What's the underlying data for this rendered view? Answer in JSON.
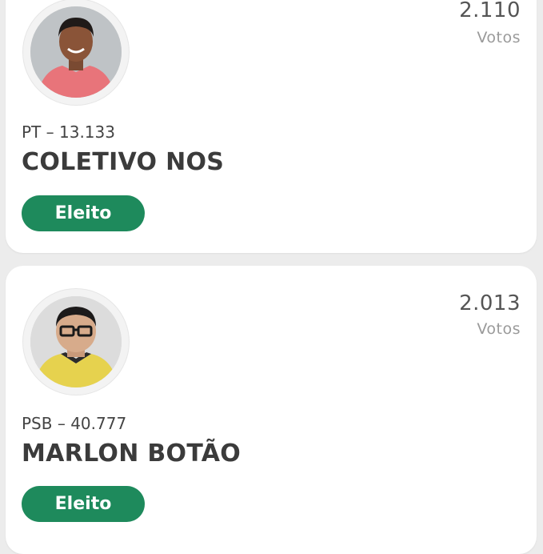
{
  "candidates": [
    {
      "votes": "2.110",
      "votes_label": "Votos",
      "party_number": "PT – 13.133",
      "name": "COLETIVO NOS",
      "status": "Eleito"
    },
    {
      "votes": "2.013",
      "votes_label": "Votos",
      "party_number": "PSB – 40.777",
      "name": "MARLON BOTÃO",
      "status": "Eleito"
    }
  ],
  "colors": {
    "badge_green": "#1e8a5c",
    "background": "#ececec"
  }
}
